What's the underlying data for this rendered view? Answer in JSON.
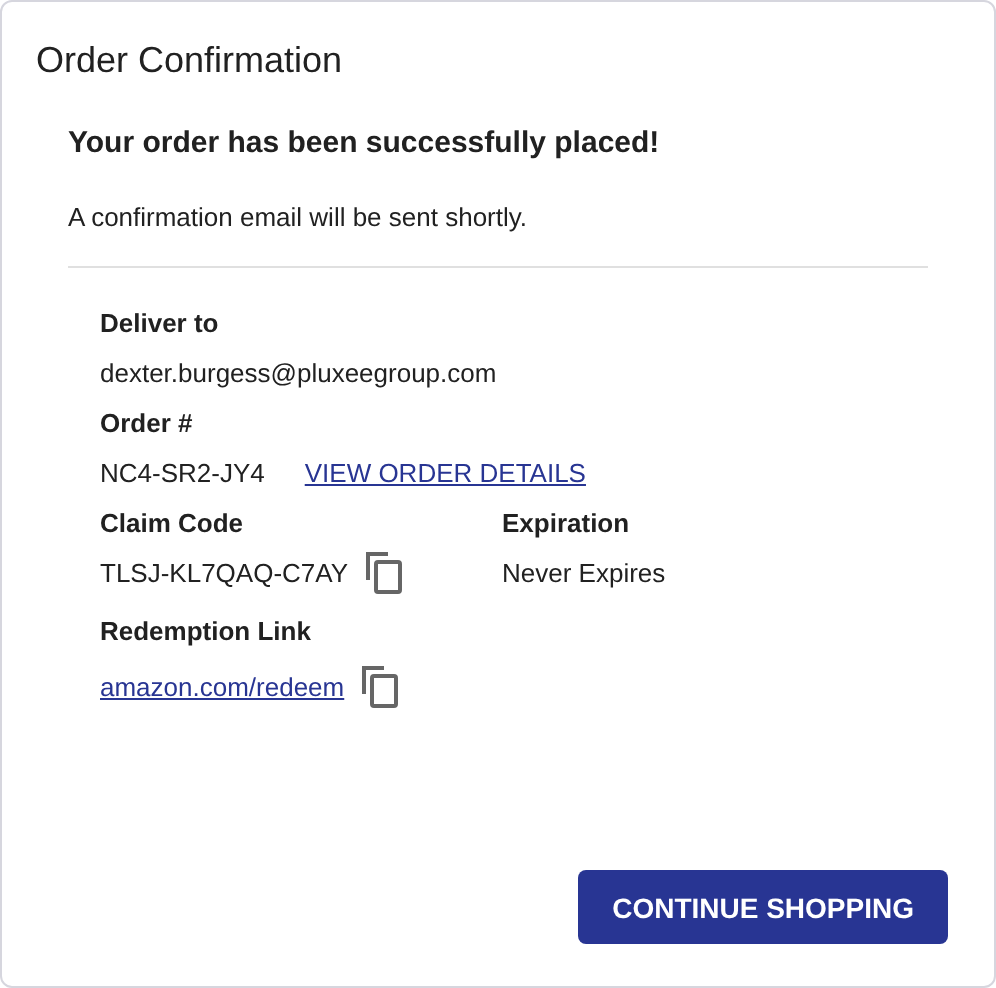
{
  "dialog": {
    "title": "Order Confirmation"
  },
  "heading": "Your order has been successfully placed!",
  "message": "A confirmation email will be sent shortly.",
  "deliver_to": {
    "label": "Deliver to",
    "value": "dexter.burgess@pluxeegroup.com"
  },
  "order": {
    "label": "Order #",
    "value": "NC4-SR2-JY4",
    "link": "VIEW ORDER DETAILS"
  },
  "claim_code": {
    "label": "Claim Code",
    "value": "TLSJ-KL7QAQ-C7AY"
  },
  "expiration": {
    "label": "Expiration",
    "value": "Never Expires"
  },
  "redemption": {
    "label": "Redemption Link",
    "link": "amazon.com/redeem"
  },
  "buttons": [
    "CONTINUE SHOPPING"
  ]
}
